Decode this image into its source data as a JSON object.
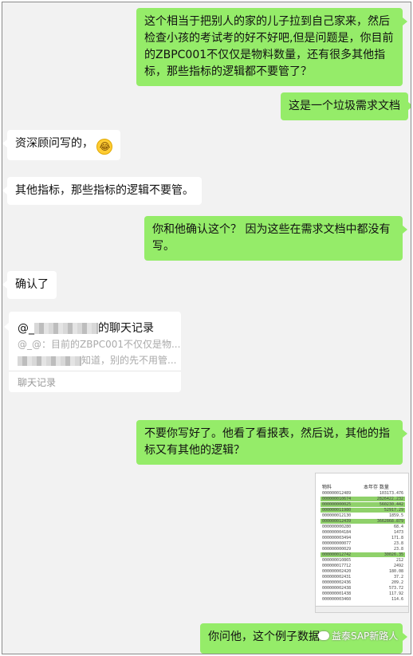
{
  "messages": [
    {
      "side": "right",
      "text": "这个相当于把别人的家的儿子拉到自己家来，然后检查小孩的考试考的好不好吧,但是问题是，你目前的ZBPC001不仅仅是物料数量，还有很多其他指标，那些指标的逻辑都不要管了？"
    },
    {
      "side": "right",
      "text": "这是一个垃圾需求文档"
    },
    {
      "side": "left",
      "text": "资深顾问写的，",
      "emoji": "laughing-tears"
    },
    {
      "side": "left",
      "text": "其他指标，那些指标的逻辑不要管。"
    },
    {
      "side": "right",
      "text": "你和他确认这个？ 因为这些在需求文档中都没有写。"
    },
    {
      "side": "left",
      "text": "确认了"
    },
    {
      "side": "right",
      "text": "不要你写好了。他看了看报表，然后说，其他的指标又有其他的逻辑？"
    },
    {
      "side": "right",
      "text": "你问他，这个例子数据"
    }
  ],
  "chat_record_card": {
    "title_prefix": "@_",
    "title_suffix": "的聊天记录",
    "line1": "@_@：目前的ZBPC001不仅仅是物...",
    "line2_suffix": "知道，别的先不用管...",
    "footer": "聊天记录"
  },
  "spreadsheet_thumb": {
    "header_left": "物料",
    "header_right": "本年存 数量",
    "rows": [
      {
        "code": "000000012489",
        "val": "103173.476",
        "hl": false
      },
      {
        "code": "000000010674",
        "val": "2826422.232",
        "hl": true
      },
      {
        "code": "000000000025",
        "val": "560230.442",
        "hl": true
      },
      {
        "code": "000000011980",
        "val": "52917.29",
        "hl": true
      },
      {
        "code": "000000012130",
        "val": "1859.5",
        "hl": false
      },
      {
        "code": "000000012439",
        "val": "3662868.879",
        "hl": true
      },
      {
        "code": "000000000280",
        "val": "68.4",
        "hl": false
      },
      {
        "code": "000000004184",
        "val": "1473",
        "hl": false
      },
      {
        "code": "000000003494",
        "val": "171.8",
        "hl": false
      },
      {
        "code": "000000000077",
        "val": "23.8",
        "hl": false
      },
      {
        "code": "000000000029",
        "val": "23.8",
        "hl": false
      },
      {
        "code": "000000012742",
        "val": "30026.35",
        "hl": true
      },
      {
        "code": "000000010865",
        "val": "212",
        "hl": false
      },
      {
        "code": "000000017712",
        "val": "2492",
        "hl": false
      },
      {
        "code": "000000002420",
        "val": "180.08",
        "hl": false
      },
      {
        "code": "000000002431",
        "val": "37.2",
        "hl": false
      },
      {
        "code": "000000002436",
        "val": "209.2",
        "hl": false
      },
      {
        "code": "000000002438",
        "val": "573.72",
        "hl": false
      },
      {
        "code": "000000001438",
        "val": "117.92",
        "hl": false
      },
      {
        "code": "000000003460",
        "val": "114.6",
        "hl": false
      }
    ]
  },
  "watermark": "益泰SAP新路人",
  "colors": {
    "bubble_right": "#95ec69",
    "bubble_left": "#ffffff",
    "background": "#f2f2f2"
  }
}
